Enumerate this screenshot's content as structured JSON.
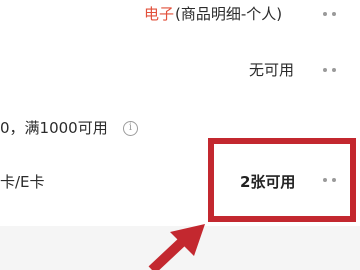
{
  "invoice": {
    "type_label": "电子",
    "detail_label": "(商品明细-个人)"
  },
  "coupon": {
    "status": "无可用"
  },
  "discount": {
    "text": "0，满1000可用"
  },
  "gift_card": {
    "label": "卡/E卡",
    "count_label": "2张可用"
  },
  "colors": {
    "accent": "#e2503b",
    "highlight": "#c3282f"
  },
  "icons": {
    "more": "more-dots-icon",
    "info": "info-icon",
    "arrow": "annotation-arrow"
  }
}
